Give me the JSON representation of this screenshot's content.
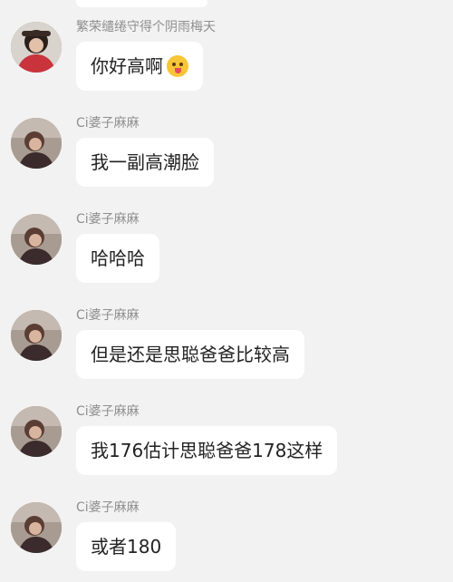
{
  "messages": [
    {
      "sender": "繁荣缱绻守得个阴雨梅天",
      "text": "你好高啊",
      "emoji": "tongue-face-emoji",
      "avatar": "girl-red-top-avatar"
    },
    {
      "sender": "Ci婆子麻麻",
      "text": "我一副高潮脸",
      "avatar": "ci-avatar"
    },
    {
      "sender": "Ci婆子麻麻",
      "text": "哈哈哈",
      "avatar": "ci-avatar"
    },
    {
      "sender": "Ci婆子麻麻",
      "text": "但是还是思聪爸爸比较高",
      "avatar": "ci-avatar"
    },
    {
      "sender": "Ci婆子麻麻",
      "text": "我176估计思聪爸爸178这样",
      "avatar": "ci-avatar"
    },
    {
      "sender": "Ci婆子麻麻",
      "text": "或者180",
      "avatar": "ci-avatar"
    }
  ]
}
